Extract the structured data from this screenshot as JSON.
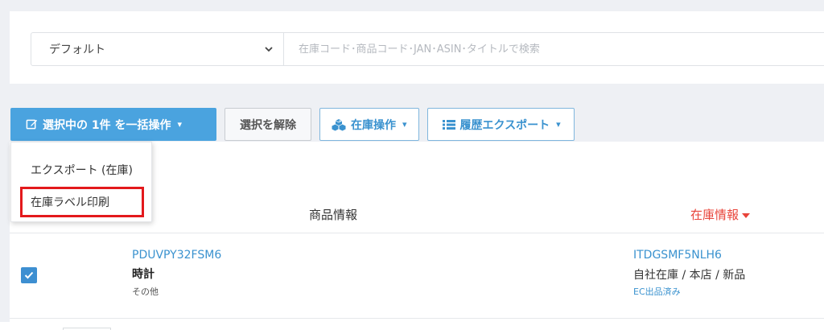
{
  "filter": {
    "select_value": "デフォルト",
    "search_placeholder": "在庫コード･商品コード･JAN･ASIN･タイトルで検索"
  },
  "toolbar": {
    "bulk_label": "選択中の 1件 を一括操作",
    "bulk_caret": "▾",
    "deselect_label": "選択を解除",
    "stock_ops_label": "在庫操作",
    "stock_ops_caret": "▾",
    "history_export_label": "履歴エクスポート",
    "history_export_caret": "▾"
  },
  "dropdown": {
    "items": [
      {
        "label": "エクスポート (在庫)"
      },
      {
        "label": "在庫ラベル印刷",
        "highlighted": true
      }
    ]
  },
  "table": {
    "columns": {
      "product": "商品情報",
      "stock": "在庫情報"
    },
    "rows": [
      {
        "checked": true,
        "product_code": "PDUVPY32FSM6",
        "title": "時計",
        "category": "その他",
        "stock_code": "ITDGSMF5NLH6",
        "location": "自社在庫 / 本店 / 新品",
        "ec_status": "EC出品済み"
      }
    ]
  },
  "colors": {
    "accent": "#4aa3df",
    "link": "#3a92cf",
    "sort_active": "#e8443a",
    "highlight_box": "#e3191c"
  },
  "icons": {
    "bulk": "edit-icon",
    "stock_ops": "cubes-icon",
    "history_export": "list-icon",
    "select": "chevron-down-icon",
    "sort": "caret-down-icon",
    "checkbox": "check-icon"
  }
}
